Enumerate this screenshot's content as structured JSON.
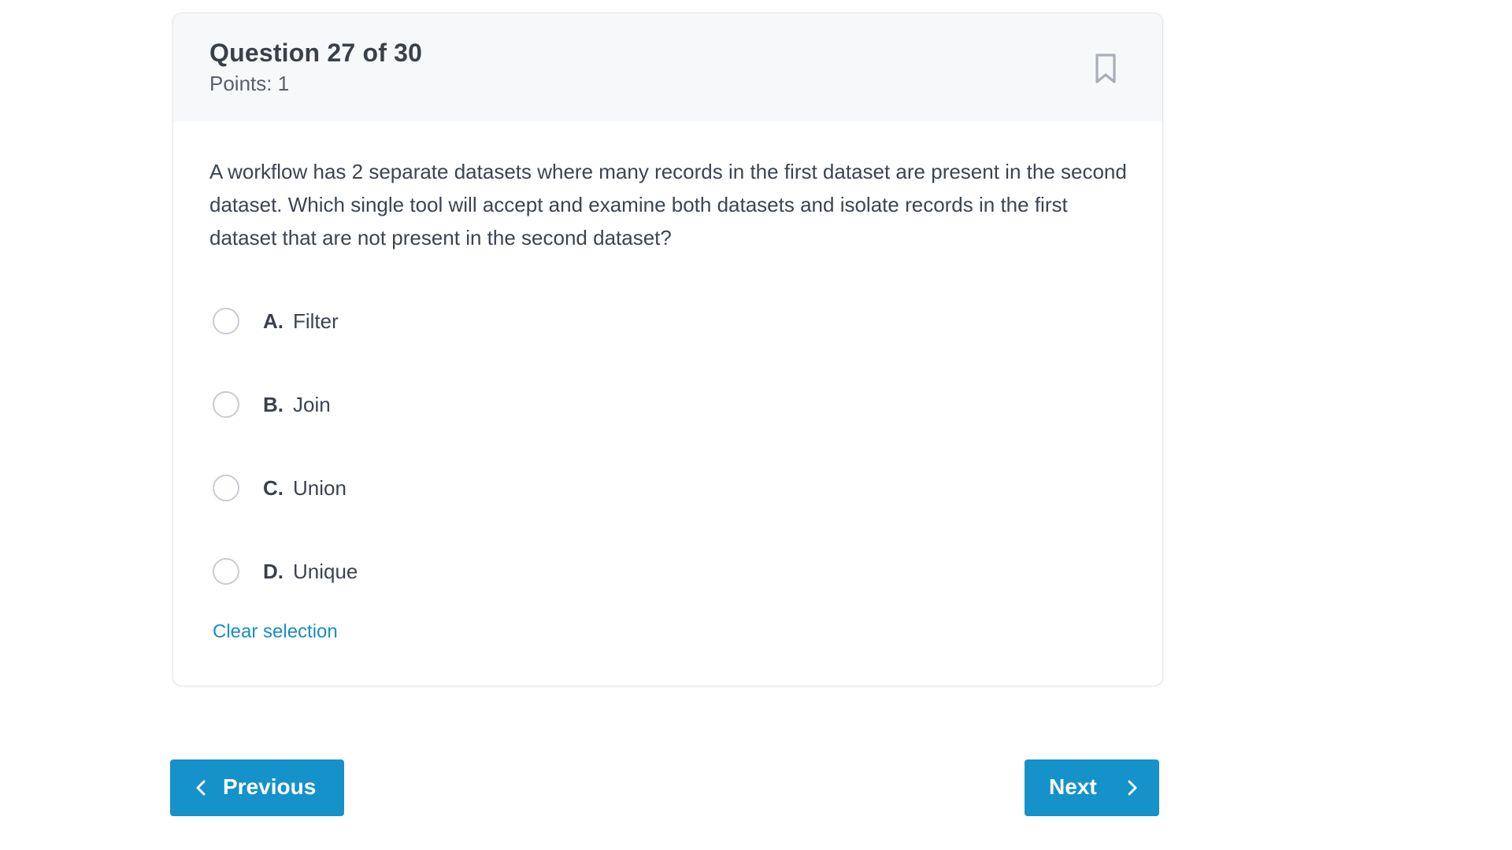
{
  "question": {
    "title": "Question 27 of 30",
    "points": "Points: 1",
    "text": "A workflow has 2 separate datasets where many records in the first dataset are present in the second dataset. Which single tool will accept and examine both datasets and isolate records in the first dataset that are not present in the second dataset?",
    "bookmark_icon": "bookmark-icon"
  },
  "options": [
    {
      "letter": "A.",
      "text": "Filter",
      "selected": false
    },
    {
      "letter": "B.",
      "text": "Join",
      "selected": false
    },
    {
      "letter": "C.",
      "text": "Union",
      "selected": false
    },
    {
      "letter": "D.",
      "text": "Unique",
      "selected": false
    }
  ],
  "clear_selection": "Clear selection",
  "nav": {
    "previous": "Previous",
    "next": "Next"
  },
  "colors": {
    "accent": "#1592c9",
    "link": "#1a8ec2",
    "header_bg": "#f7f8fa"
  }
}
